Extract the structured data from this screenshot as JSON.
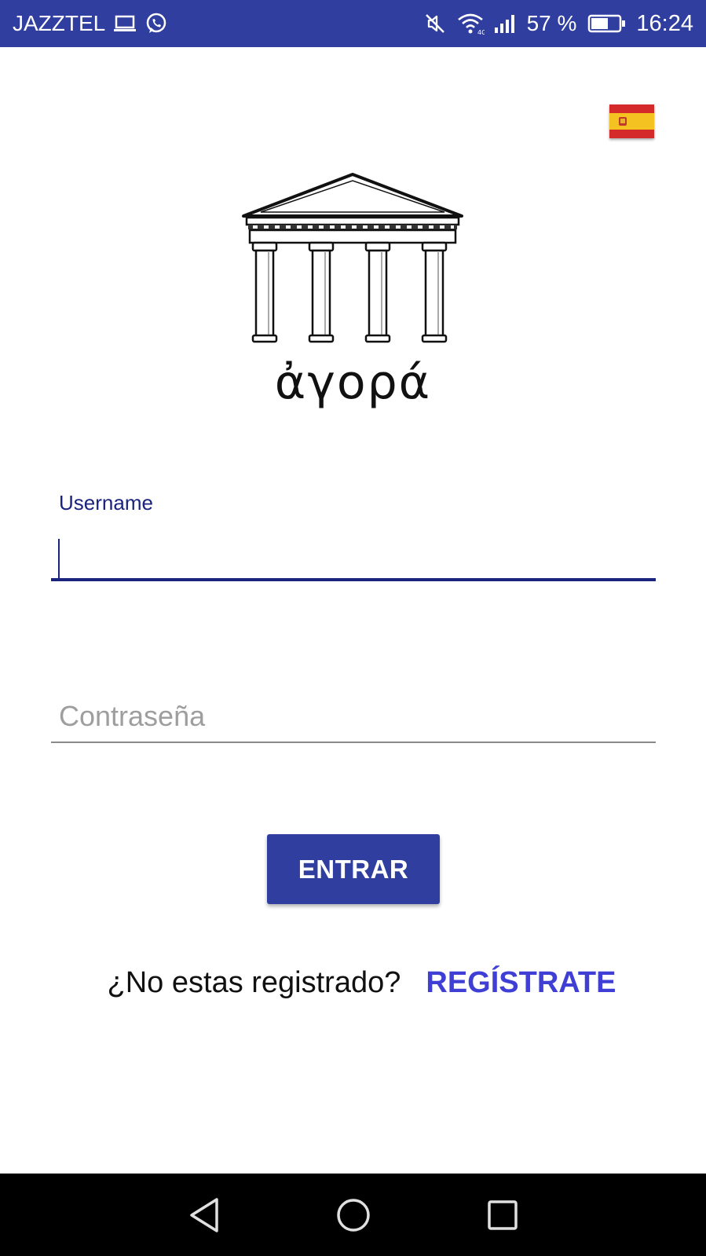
{
  "status_bar": {
    "carrier": "JAZZTEL",
    "left_icons": [
      "laptop-icon",
      "whatsapp-icon"
    ],
    "right_icons": [
      "mute-icon",
      "wifi-icon",
      "signal-icon",
      "battery-icon"
    ],
    "battery_percent": "57 %",
    "time": "16:24",
    "background_color": "#303f9f"
  },
  "language": {
    "flag_icon": "spain-flag-icon"
  },
  "logo": {
    "icon": "greek-temple-icon",
    "text": "ἀγορά"
  },
  "login_form": {
    "username_label": "Username",
    "username_value": "",
    "password_placeholder": "Contraseña",
    "password_value": "",
    "submit_label": "ENTRAR"
  },
  "register": {
    "question": "¿No estas registrado?",
    "link_label": "REGÍSTRATE"
  },
  "nav_bar": {
    "icons": [
      "back-icon",
      "home-icon",
      "recents-icon"
    ]
  },
  "colors": {
    "primary": "#303f9f",
    "label": "#1a237e",
    "link": "#3f3fd6"
  }
}
